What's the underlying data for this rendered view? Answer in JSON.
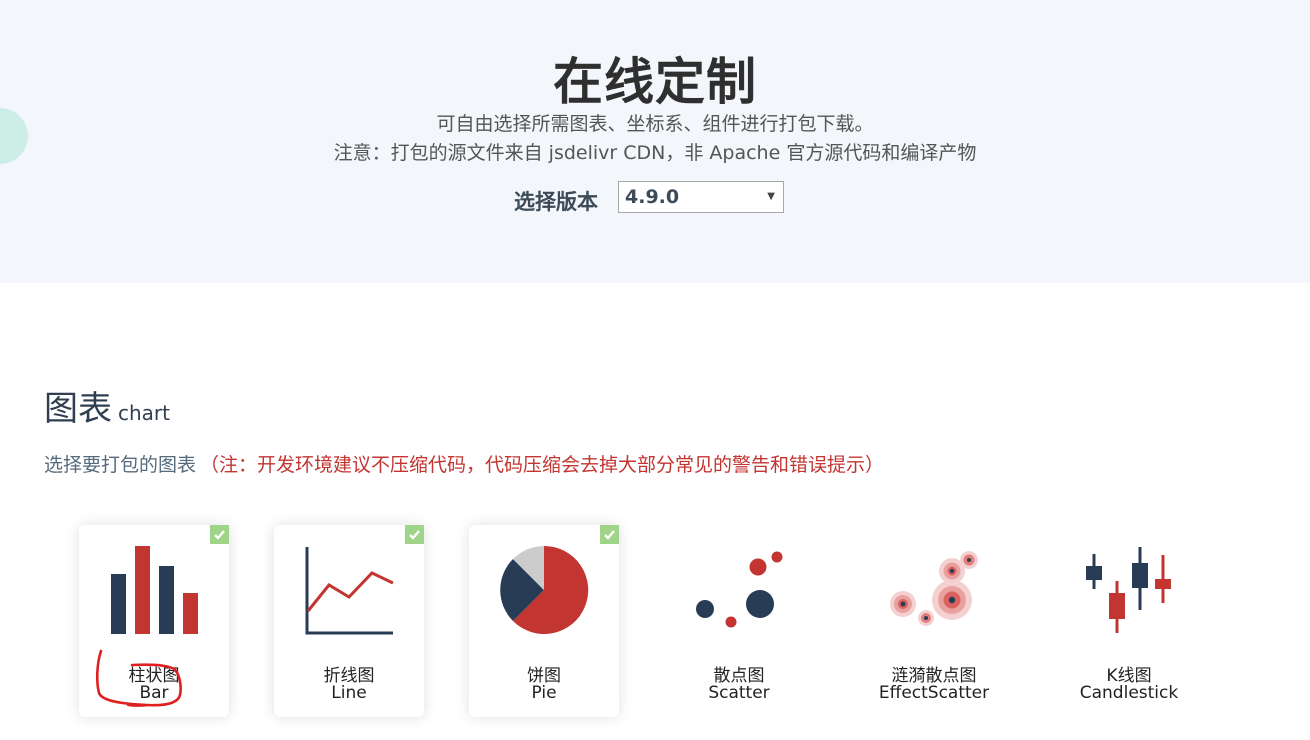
{
  "header": {
    "title": "在线定制",
    "line1": "可自由选择所需图表、坐标系、组件进行打包下载。",
    "line2": "注意：打包的源文件来自 jsdelivr CDN，非 Apache 官方源代码和编译产物",
    "version_label": "选择版本",
    "version_value": "4.9.0"
  },
  "section": {
    "title": "图表",
    "subtitle": "chart",
    "description": "选择要打包的图表",
    "warning": "（注：开发环境建议不压缩代码，代码压缩会去掉大部分常见的警告和错误提示）"
  },
  "charts": [
    {
      "zh": "柱状图",
      "en": "Bar",
      "selected": true,
      "icon": "bar-chart-icon"
    },
    {
      "zh": "折线图",
      "en": "Line",
      "selected": true,
      "icon": "line-chart-icon"
    },
    {
      "zh": "饼图",
      "en": "Pie",
      "selected": true,
      "icon": "pie-chart-icon"
    },
    {
      "zh": "散点图",
      "en": "Scatter",
      "selected": false,
      "icon": "scatter-chart-icon"
    },
    {
      "zh": "涟漪散点图",
      "en": "EffectScatter",
      "selected": false,
      "icon": "effect-scatter-icon"
    },
    {
      "zh": "K线图",
      "en": "Candlestick",
      "selected": false,
      "icon": "candlestick-icon"
    }
  ],
  "colors": {
    "dark": "#293c55",
    "red": "#c23531",
    "grey": "#cccccc",
    "check": "#9fd489",
    "hero_bg": "#f3f6fa"
  }
}
